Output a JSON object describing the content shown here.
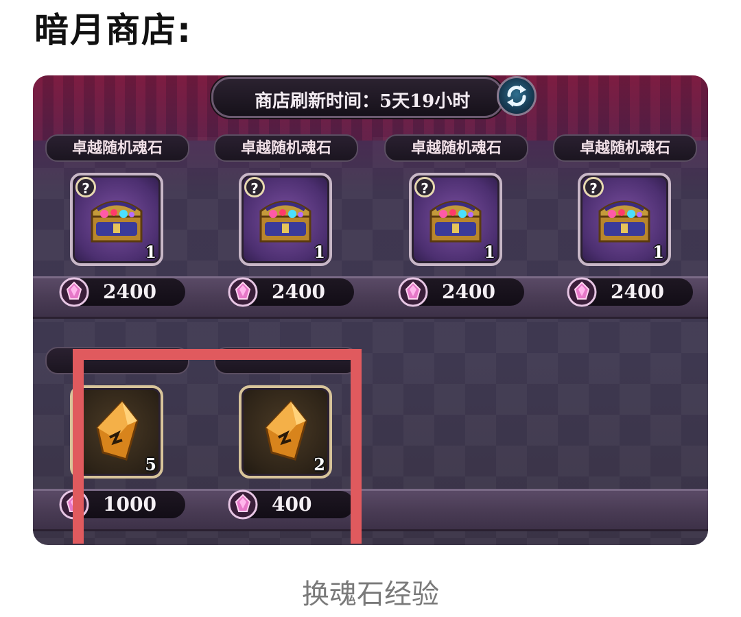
{
  "heading": "暗月商店:",
  "shop": {
    "refresh_text": "商店刷新时间：5天19小时",
    "refresh_icon": "refresh-icon",
    "currency_icon": "soul-gem-icon",
    "items": [
      {
        "title": "卓越随机魂石",
        "icon": "treasure-chest-icon",
        "quantity": "1",
        "price": "2400"
      },
      {
        "title": "卓越随机魂石",
        "icon": "treasure-chest-icon",
        "quantity": "1",
        "price": "2400"
      },
      {
        "title": "卓越随机魂石",
        "icon": "treasure-chest-icon",
        "quantity": "1",
        "price": "2400"
      },
      {
        "title": "卓越随机魂石",
        "icon": "treasure-chest-icon",
        "quantity": "1",
        "price": "2400"
      },
      {
        "title": "",
        "icon": "soul-crystal-icon",
        "quantity": "5",
        "price": "1000"
      },
      {
        "title": "",
        "icon": "soul-crystal-icon",
        "quantity": "2",
        "price": "400"
      }
    ]
  },
  "highlight_color": "#e05a5e",
  "caption": "换魂石经验"
}
